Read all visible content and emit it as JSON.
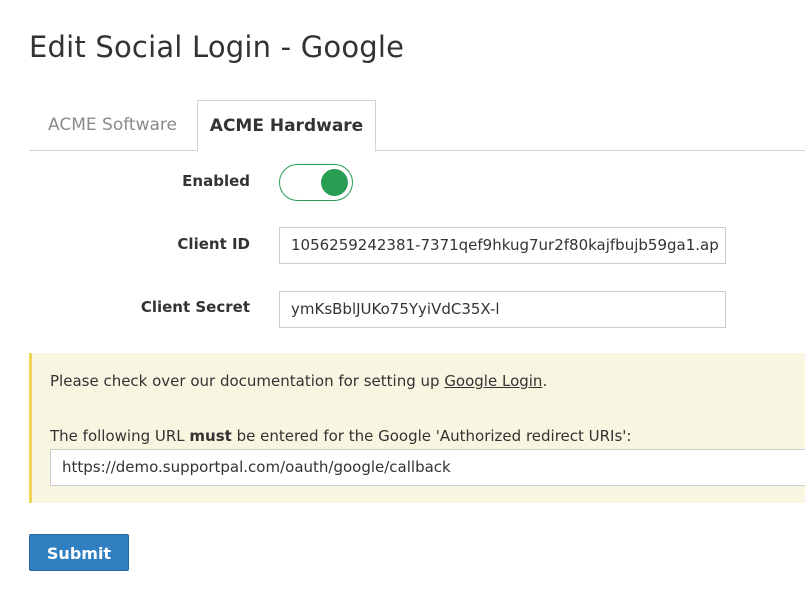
{
  "page": {
    "title": "Edit Social Login - Google"
  },
  "tabs": [
    {
      "label": "ACME Software",
      "active": false
    },
    {
      "label": "ACME Hardware",
      "active": true
    }
  ],
  "form": {
    "enabled_label": "Enabled",
    "enabled_value": true,
    "client_id_label": "Client ID",
    "client_id_value": "1056259242381-7371qef9hkug7ur2f80kajfbujb59ga1.ap",
    "client_secret_label": "Client Secret",
    "client_secret_value": "ymKsBblJUKo75YyiVdC35X-l"
  },
  "notice": {
    "doc_prefix": "Please check over our documentation for setting up ",
    "doc_link": "Google Login",
    "doc_suffix": ".",
    "url_prefix": "The following URL ",
    "url_emphasis": "must",
    "url_suffix": " be entered for the Google 'Authorized redirect URIs':",
    "redirect_url": "https://demo.supportpal.com/oauth/google/callback"
  },
  "actions": {
    "submit_label": "Submit"
  },
  "colors": {
    "toggle_on": "#2a9d55",
    "notice_bg": "#f8f5e0",
    "notice_border": "#f0d25a",
    "primary_button": "#2f7fc1"
  }
}
